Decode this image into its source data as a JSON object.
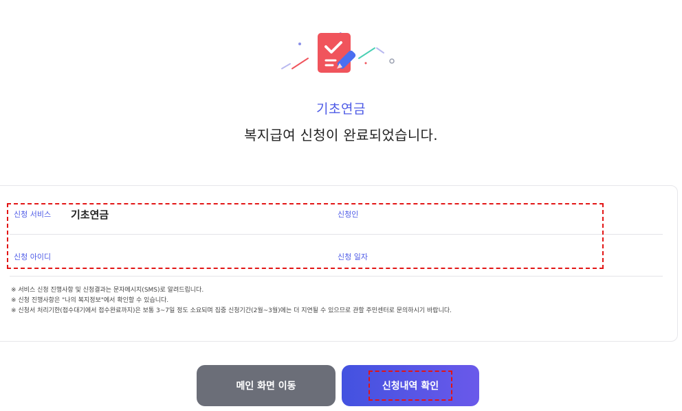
{
  "hero": {
    "title": "기초연금",
    "subtitle": "복지급여 신청이 완료되었습니다."
  },
  "info": {
    "service_label": "신청 서비스",
    "service_value": "기초연금",
    "applicant_label": "신청인",
    "id_label": "신청 아이디",
    "date_label": "신청 일자"
  },
  "notes": [
    "※ 서비스 신청 진행사항 및 신청결과는 문자메시지(SMS)로 알려드립니다.",
    "※ 신청 진행사항은 \"나의 복지정보\"에서 확인할 수 있습니다.",
    "※ 신청서 처리기한(접수대기에서 접수완료까지)은 보통 3~7일 정도 소요되며 집중 신청기간(2월~3월)에는 더 지연될 수 있으므로 관할 주민센터로 문의하시기 바랍니다."
  ],
  "buttons": {
    "main": "메인 화면 이동",
    "history": "신청내역 확인"
  },
  "colors": {
    "accent": "#4d5ae6",
    "icon_red": "#f0545c",
    "highlight_red": "#e21414",
    "gray_button": "#6b6e78"
  }
}
